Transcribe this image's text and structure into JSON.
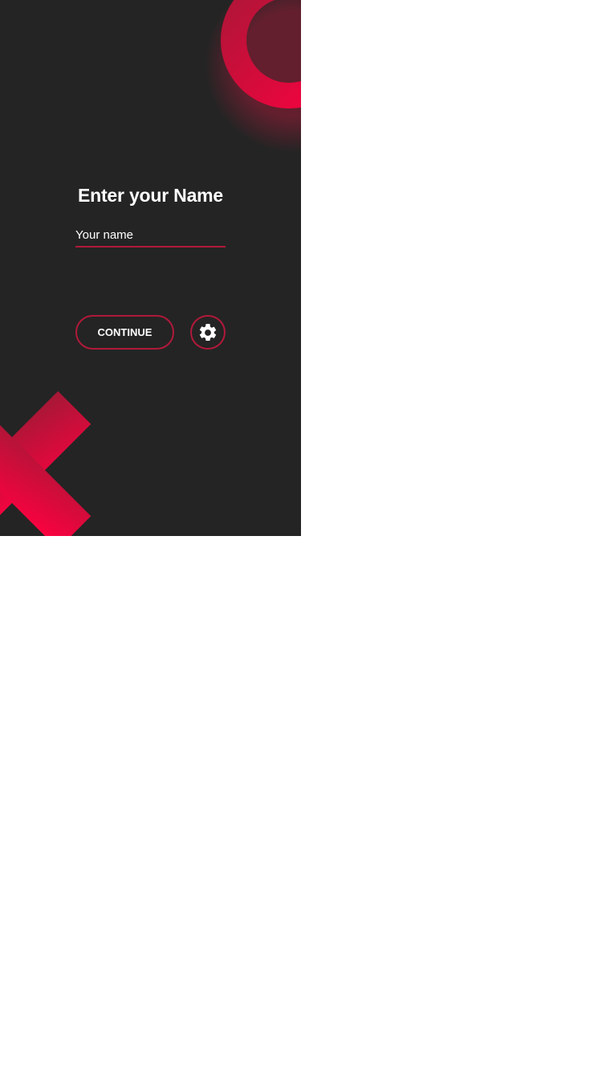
{
  "screen": {
    "title": "Enter your Name",
    "name_input": {
      "placeholder": "Your name",
      "value": ""
    },
    "continue_label": "CONTINUE",
    "settings_icon": "gear-icon"
  },
  "colors": {
    "background": "#242424",
    "accent": "#b0193a",
    "accent_bright": "#ff0040",
    "text": "#ffffff"
  }
}
